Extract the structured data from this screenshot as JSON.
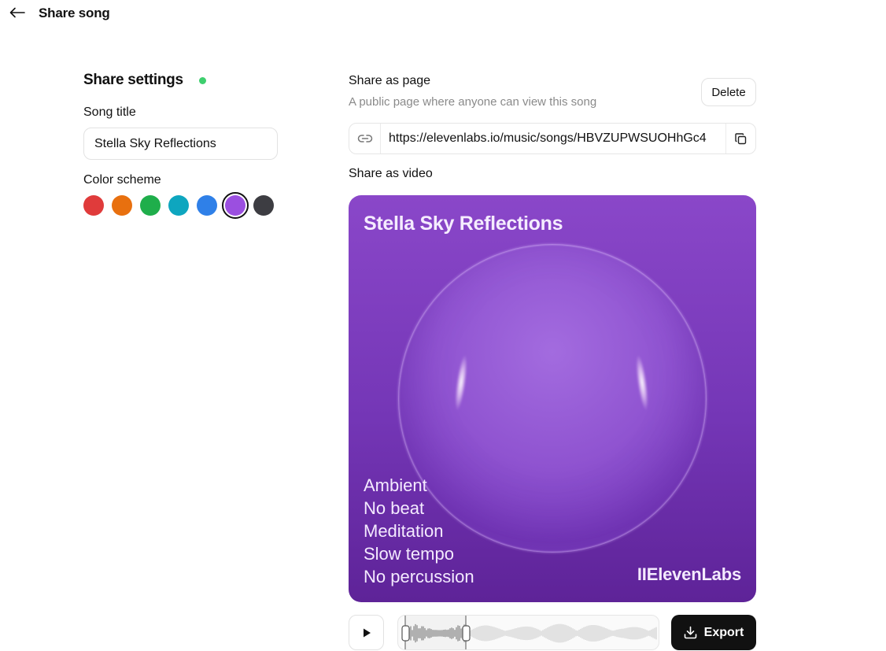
{
  "header": {
    "title": "Share song",
    "back_icon": "arrow-left-icon"
  },
  "settings": {
    "title": "Share settings",
    "status_color": "#3ecf6e",
    "song_title_label": "Song title",
    "song_title_value": "Stella Sky Reflections",
    "color_scheme_label": "Color scheme",
    "colors": [
      {
        "name": "red",
        "hex": "#e03b3b",
        "selected": false
      },
      {
        "name": "orange",
        "hex": "#e8700f",
        "selected": false
      },
      {
        "name": "green",
        "hex": "#1fae4b",
        "selected": false
      },
      {
        "name": "teal",
        "hex": "#0ea6bf",
        "selected": false
      },
      {
        "name": "blue",
        "hex": "#2f80e8",
        "selected": false
      },
      {
        "name": "purple",
        "hex": "#9b4fe0",
        "selected": true
      },
      {
        "name": "dark-gray",
        "hex": "#3d3d42",
        "selected": false
      }
    ]
  },
  "share_page": {
    "title": "Share as page",
    "subtitle": "A public page where anyone can view this song",
    "delete_label": "Delete",
    "url": "https://elevenlabs.io/music/songs/HBVZUPWSUOHhGc4",
    "link_icon": "link-icon",
    "copy_icon": "copy-icon"
  },
  "share_video": {
    "title": "Share as video",
    "card_title": "Stella Sky Reflections",
    "tags": [
      "Ambient",
      "No beat",
      "Meditation",
      "Slow tempo",
      "No percussion"
    ],
    "brand": "IIElevenLabs",
    "accent": "#8a47c9"
  },
  "player": {
    "play_icon": "play-icon",
    "export_label": "Export",
    "export_icon": "download-icon"
  }
}
